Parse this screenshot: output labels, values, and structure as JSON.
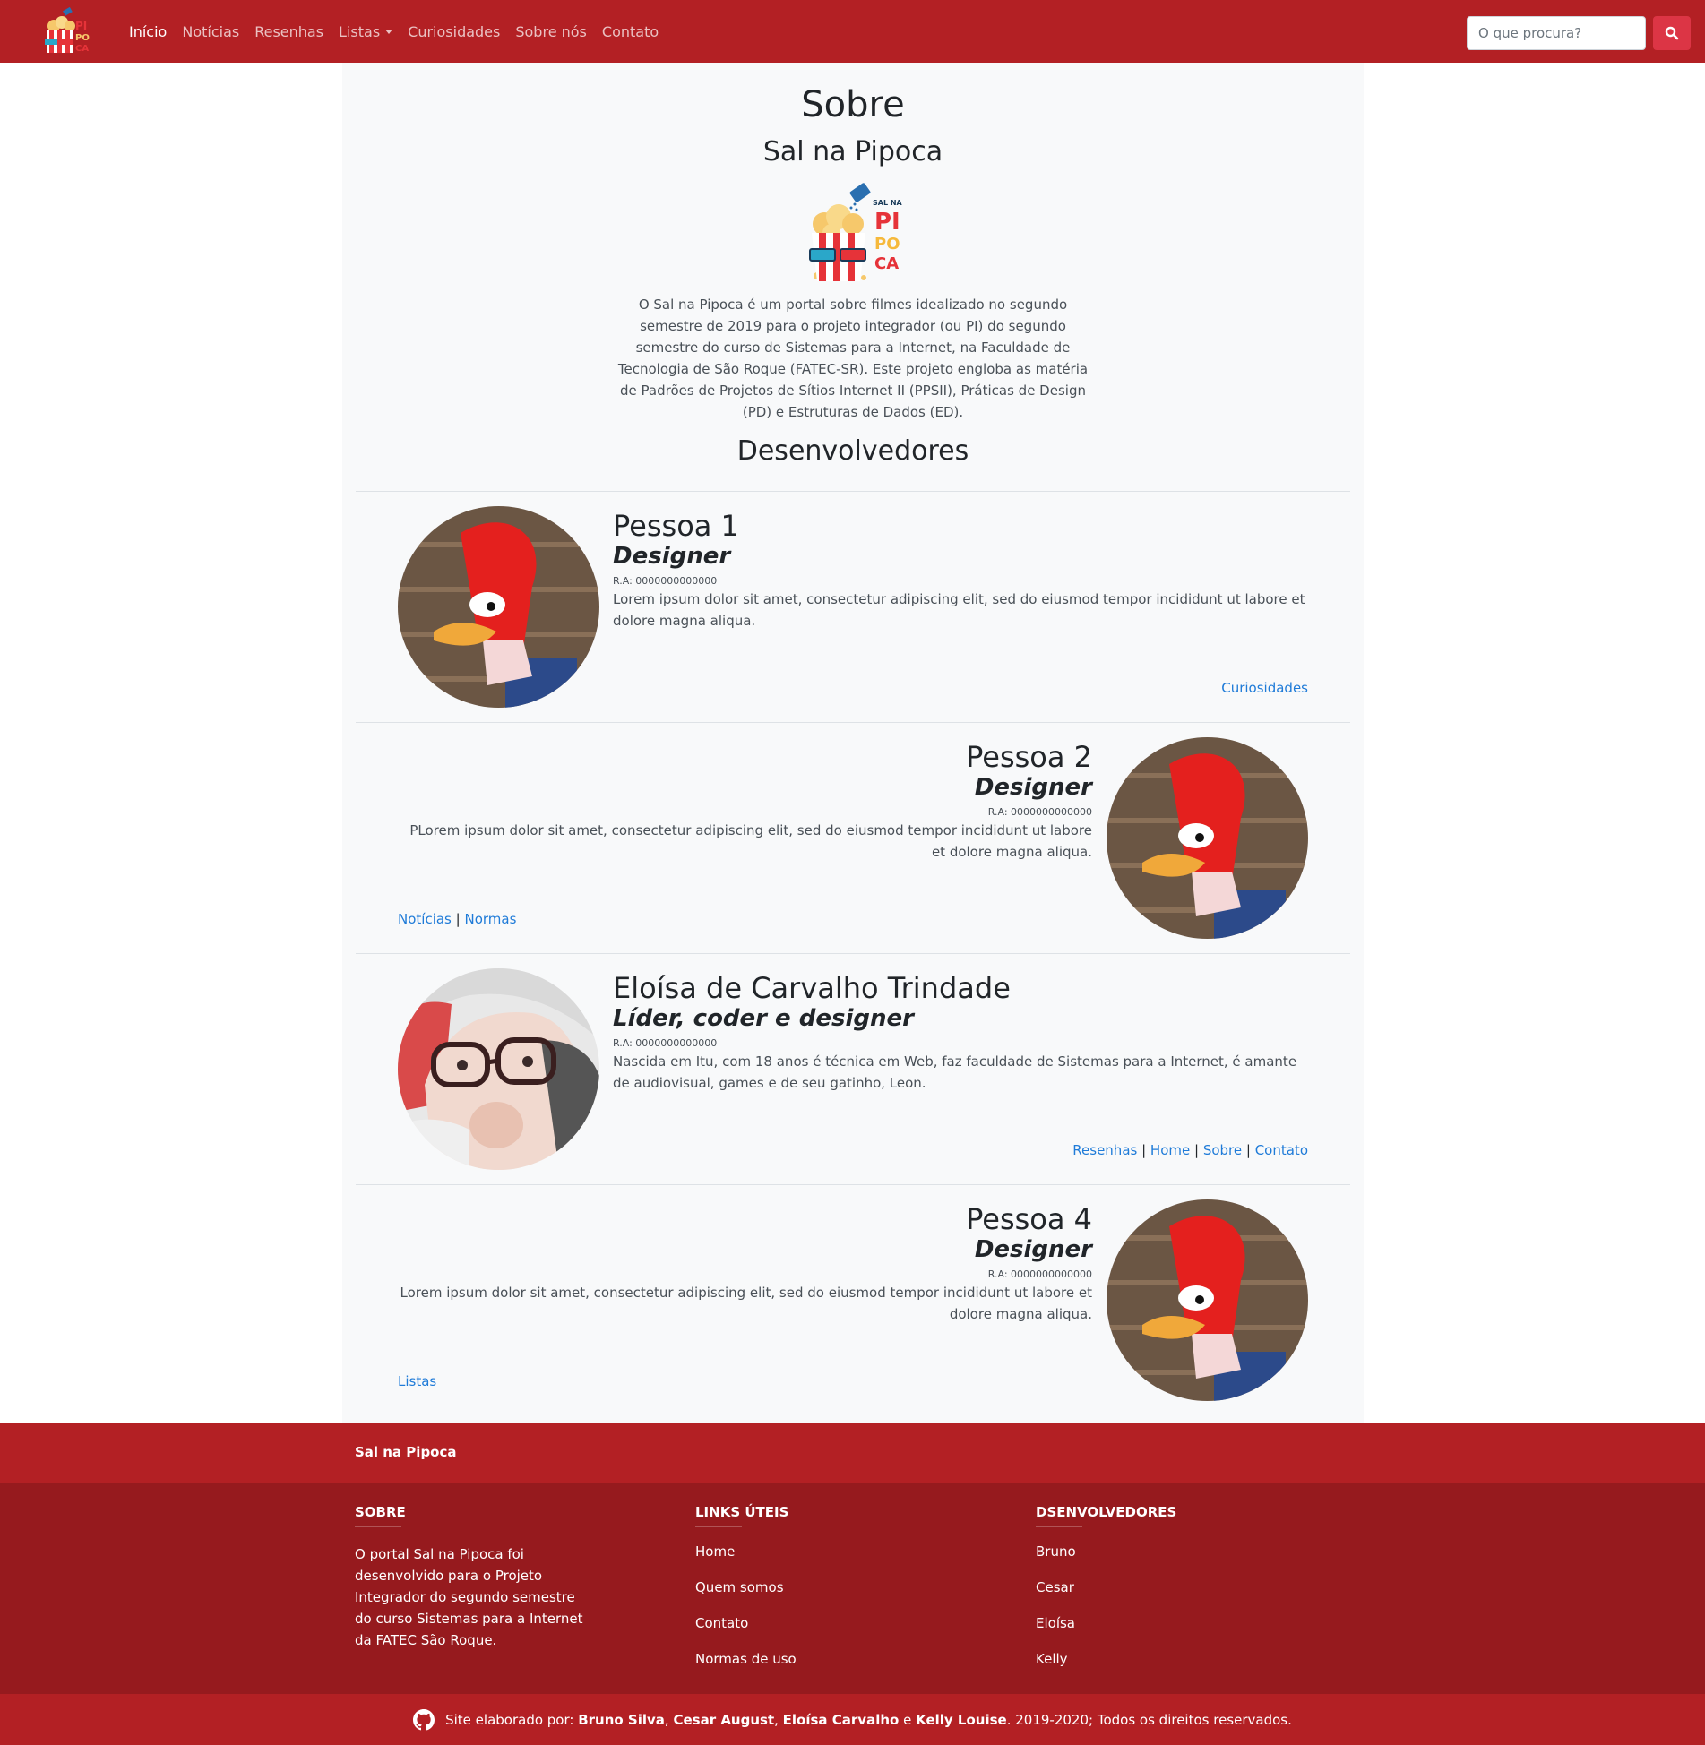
{
  "brand": {
    "logo_text": [
      "PI",
      "PO",
      "CA"
    ],
    "logo_tag": "SAL NA"
  },
  "nav": {
    "items": [
      "Início",
      "Notícias",
      "Resenhas",
      "Listas",
      "Curiosidades",
      "Sobre nós",
      "Contato"
    ],
    "active_index": 0
  },
  "search": {
    "placeholder": "O que procura?"
  },
  "page": {
    "title": "Sobre",
    "subtitle": "Sal na Pipoca",
    "about": "O Sal na Pipoca é um portal sobre filmes idealizado no segundo semestre de 2019 para o projeto integrador (ou PI) do segundo semestre do curso de Sistemas para a Internet, na Faculdade de Tecnologia de São Roque (FATEC-SR). Este projeto engloba as matéria de Padrões de Projetos de Sítios Internet II (PPSII), Práticas de Design (PD) e Estruturas de Dados (ED).",
    "devs_heading": "Desenvolvedores"
  },
  "developers": [
    {
      "name": "Pessoa 1",
      "role": "Designer",
      "ra": "R.A: 0000000000000",
      "description": "Lorem ipsum dolor sit amet, consectetur adipiscing elit, sed do eiusmod tempor incididunt ut labore et dolore magna aliqua.",
      "links": [
        "Curiosidades"
      ],
      "align": "left"
    },
    {
      "name": "Pessoa 2",
      "role": "Designer",
      "ra": "R.A: 0000000000000",
      "description": "PLorem ipsum dolor sit amet, consectetur adipiscing elit, sed do eiusmod tempor incididunt ut labore et dolore magna aliqua.",
      "links": [
        "Notícias",
        "Normas"
      ],
      "align": "right"
    },
    {
      "name": "Eloísa de Carvalho Trindade",
      "role": "Líder, coder e designer",
      "ra": "R.A: 0000000000000",
      "description": "Nascida em Itu, com 18 anos é técnica em Web, faz faculdade de Sistemas para a Internet, é amante de audiovisual, games e de seu gatinho, Leon.",
      "links": [
        "Resenhas",
        "Home",
        "Sobre",
        "Contato"
      ],
      "align": "left"
    },
    {
      "name": "Pessoa 4",
      "role": "Designer",
      "ra": "R.A: 0000000000000",
      "description": "Lorem ipsum dolor sit amet, consectetur adipiscing elit, sed do eiusmod tempor incididunt ut labore et dolore magna aliqua.",
      "links": [
        "Listas"
      ],
      "align": "right"
    }
  ],
  "footer": {
    "brand": "Sal na Pipoca",
    "about_heading": "SOBRE",
    "about_text": "O portal Sal na Pipoca foi desenvolvido para o Projeto Integrador do segundo semestre do curso Sistemas para a Internet da FATEC São Roque.",
    "links_heading": "LINKS ÚTEIS",
    "links": [
      "Home",
      "Quem somos",
      "Contato",
      "Normas de uso"
    ],
    "devs_heading": "DSENVOLVEDORES",
    "devs": [
      "Bruno",
      "Cesar",
      "Eloísa",
      "Kelly"
    ],
    "credit_prefix": "Site elaborado por: ",
    "credit_names": [
      "Bruno Silva",
      "Cesar August",
      "Eloísa Carvalho",
      "Kelly Louise"
    ],
    "credit_separators": [
      ", ",
      ", ",
      " e "
    ],
    "credit_suffix": ". 2019-2020; Todos os direitos reservados."
  },
  "colors": {
    "primary": "#b32024",
    "footer_dark": "#961a1e",
    "link": "#1f7bd8",
    "search_button": "#dc3545"
  }
}
